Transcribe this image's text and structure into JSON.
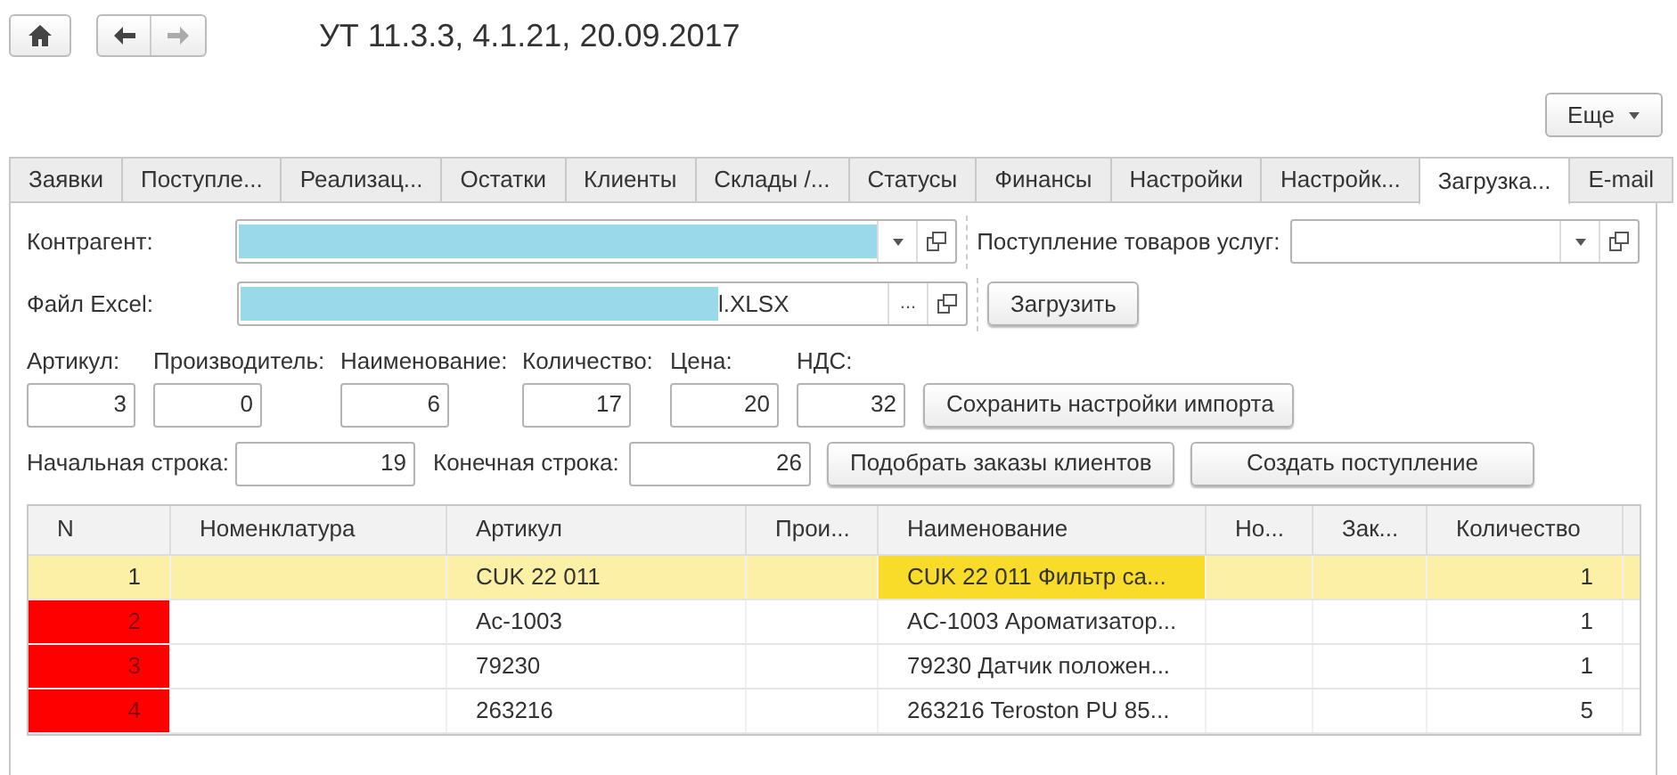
{
  "window": {
    "title": "УТ 11.3.3, 4.1.21, 20.09.2017"
  },
  "more_button": "Еще",
  "tabs": [
    {
      "label": "Заявки",
      "selected": false
    },
    {
      "label": "Поступле...",
      "selected": false
    },
    {
      "label": "Реализац...",
      "selected": false
    },
    {
      "label": "Остатки",
      "selected": false
    },
    {
      "label": "Клиенты",
      "selected": false
    },
    {
      "label": "Склады /...",
      "selected": false
    },
    {
      "label": "Статусы",
      "selected": false
    },
    {
      "label": "Финансы",
      "selected": false
    },
    {
      "label": "Настройки",
      "selected": false
    },
    {
      "label": "Настройк...",
      "selected": false
    },
    {
      "label": "Загрузка...",
      "selected": true
    },
    {
      "label": "E-mail",
      "selected": false
    }
  ],
  "counterparty": {
    "label": "Контрагент:"
  },
  "receipt": {
    "label": "Поступление товаров услуг:"
  },
  "excel_file": {
    "label": "Файл Excel:",
    "value": "l.XLSX",
    "button": "..."
  },
  "load_button": "Загрузить",
  "columns_map": [
    {
      "label": "Артикул:",
      "value": "3"
    },
    {
      "label": "Производитель:",
      "value": "0"
    },
    {
      "label": "Наименование:",
      "value": "6"
    },
    {
      "label": "Количество:",
      "value": "17"
    },
    {
      "label": "Цена:",
      "value": "20"
    },
    {
      "label": "НДС:",
      "value": "32"
    }
  ],
  "save_button": "Сохранить настройки импорта",
  "start_row": {
    "label": "Начальная строка:",
    "value": "19"
  },
  "end_row": {
    "label": "Конечная строка:",
    "value": "26"
  },
  "pick_button": "Подобрать заказы клиентов",
  "create_button": "Создать поступление",
  "table": {
    "columns": [
      "N",
      "Номенклатура",
      "Артикул",
      "Прои...",
      "Наименование",
      "Но...",
      "Зак...",
      "Количество"
    ],
    "rows": [
      {
        "selected": true,
        "marked": false,
        "cells": [
          "1",
          "",
          "CUK 22 011",
          "",
          "CUK 22 011 Фильтр са...",
          "",
          "",
          "1"
        ]
      },
      {
        "selected": false,
        "marked": true,
        "cells": [
          "2",
          "",
          "Ac-1003",
          "",
          "AC-1003 Ароматизатор...",
          "",
          "",
          "1"
        ]
      },
      {
        "selected": false,
        "marked": true,
        "cells": [
          "3",
          "",
          "79230",
          "",
          "79230 Датчик положен...",
          "",
          "",
          "1"
        ]
      },
      {
        "selected": false,
        "marked": true,
        "cells": [
          "4",
          "",
          "263216",
          "",
          "263216 Teroston PU 85...",
          "",
          "",
          "5"
        ]
      }
    ]
  }
}
